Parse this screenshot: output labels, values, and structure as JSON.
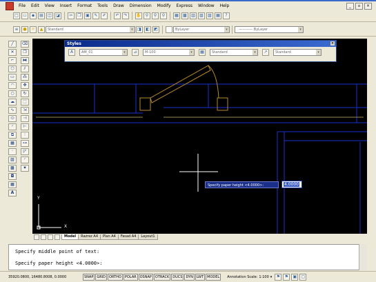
{
  "menu": {
    "items": [
      "File",
      "Edit",
      "View",
      "Insert",
      "Format",
      "Tools",
      "Draw",
      "Dimension",
      "Modify",
      "Express",
      "Window",
      "Help"
    ]
  },
  "toolbar2": {
    "workspace": "Standard",
    "layer": "ByLayer",
    "linetype": "ByLayer"
  },
  "styles_panel": {
    "title": "Styles",
    "text_style": "AM_01",
    "dim_style": "M-100",
    "table_style": "Standard",
    "mleader_style": "Standard"
  },
  "tabs": [
    "Model",
    "Razrez A4",
    "Plan A4",
    "Fasad A4",
    "Layout1"
  ],
  "active_tab": "Model",
  "command": {
    "line1": "Specify middle point of text:",
    "line2": "Specify paper height <4.0000>:"
  },
  "dynamic_input": {
    "prompt": "Specify paper height <4.0000>:",
    "value": "4.0000"
  },
  "status": {
    "coords": "35920.0800, 16480.8008, 0.0000",
    "toggles": [
      "SNAP",
      "GRID",
      "ORTHO",
      "POLAR",
      "OSNAP",
      "OTRACK",
      "DUCS",
      "DYN",
      "LWT",
      "MODEL"
    ],
    "annotation_scale_label": "Annotation Scale:",
    "annotation_scale": "1:100"
  },
  "ucs": {
    "x_label": "X",
    "y_label": "Y"
  },
  "colors": {
    "canvas_bg": "#000000",
    "wall_blue": "#1a2fd0",
    "drawing_orange": "#b88a28",
    "crosshair": "#ffffff",
    "dyn_bg": "#1a2f8a"
  }
}
